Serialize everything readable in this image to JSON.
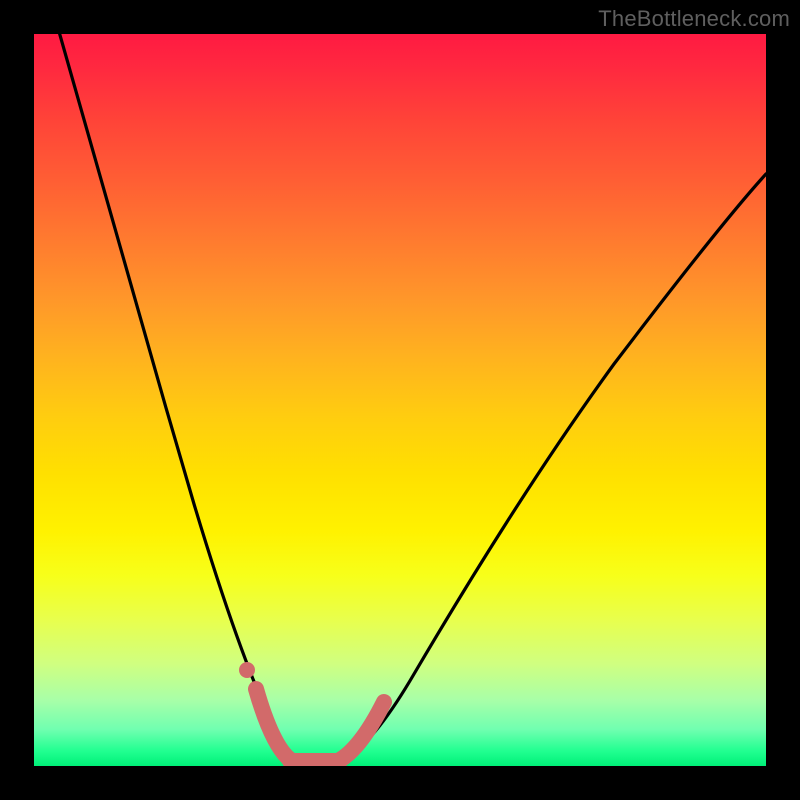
{
  "watermark": "TheBottleneck.com",
  "colors": {
    "background": "#000000",
    "curve_stroke": "#000000",
    "marker_fill": "#d26a6a",
    "gradient_top": "#ff1a42",
    "gradient_bottom": "#00f078"
  },
  "chart_data": {
    "type": "line",
    "title": "",
    "xlabel": "",
    "ylabel": "",
    "xlim": [
      0,
      100
    ],
    "ylim": [
      0,
      100
    ],
    "grid": false,
    "legend": false,
    "series": [
      {
        "name": "bottleneck-curve",
        "x": [
          1,
          5,
          10,
          15,
          20,
          24,
          27,
          30,
          32,
          33,
          34,
          36,
          38,
          40,
          45,
          55,
          65,
          75,
          85,
          95,
          100
        ],
        "values": [
          100,
          85,
          68,
          52,
          36,
          22,
          12,
          5,
          2,
          1,
          1,
          1,
          2,
          4,
          10,
          24,
          38,
          50,
          60,
          68,
          72
        ]
      }
    ],
    "markers": {
      "name": "highlight-minimum",
      "x": [
        28,
        30,
        31,
        32,
        33,
        34,
        35,
        36,
        37,
        38,
        39,
        40
      ],
      "values": [
        10,
        5,
        3,
        2,
        1,
        1,
        1,
        1,
        2,
        2,
        3,
        4
      ]
    },
    "annotations": []
  }
}
